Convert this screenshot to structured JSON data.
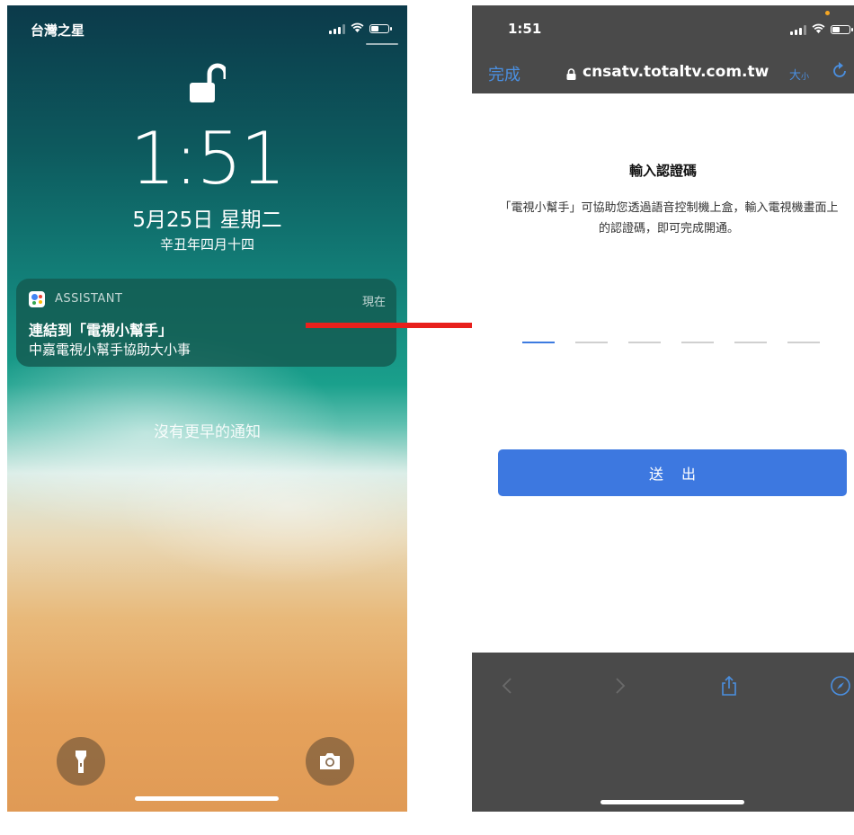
{
  "lock_screen": {
    "carrier": "台灣之星",
    "time": "1:51",
    "date": "5月25日 星期二",
    "lunar_date": "辛丑年四月十四",
    "notification": {
      "app_name": "ASSISTANT",
      "time_label": "現在",
      "title": "連結到「電視小幫手」",
      "body": "中嘉電視小幫手協助大小事"
    },
    "no_older_notifications": "沒有更早的通知",
    "icons": {
      "lock": "unlocked-padlock-icon",
      "flashlight": "flashlight-icon",
      "camera": "camera-icon"
    }
  },
  "browser": {
    "time": "1:51",
    "done_label": "完成",
    "url": "cnsatv.totaltv.com.tw",
    "text_size_label": "大",
    "text_size_small_label": "小",
    "page_title": "輸入認證碼",
    "page_description": "「電視小幫手」可協助您透過語音控制機上盒，輸入電視機畫面上的認證碼，即可完成開通。",
    "code_slot_count": 6,
    "submit_label": "送出",
    "icons": {
      "back": "chevron-left-icon",
      "forward": "chevron-right-icon",
      "share": "share-icon",
      "compass": "compass-icon",
      "reload": "reload-icon"
    }
  },
  "colors": {
    "accent_blue": "#3d78e0",
    "browser_bar": "#4a4a4a",
    "arrow_red": "#e8201c",
    "mic_indicator": "#f5a623"
  }
}
